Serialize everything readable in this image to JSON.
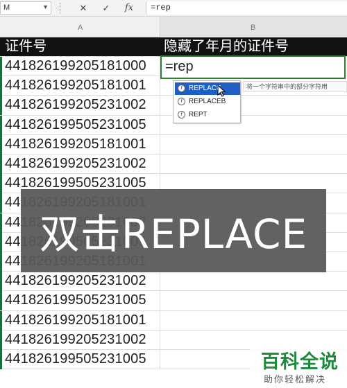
{
  "formula_bar": {
    "namebox": "M",
    "cancel_glyph": "✕",
    "enter_glyph": "✓",
    "fx_glyph": "fx",
    "formula": "=rep"
  },
  "columns": [
    "A",
    "B"
  ],
  "header": {
    "col_a": "证件号",
    "col_b": "隐藏了年月的证件号"
  },
  "active_cell": {
    "value": "=rep"
  },
  "rows": [
    "441826199205181000",
    "441826199205181001",
    "441826199205231002",
    "441826199505231005",
    "441826199205181001",
    "441826199205231002",
    "441826199505231005",
    "441826199205181001",
    "441826199205231002",
    "441826199505231005",
    "441826199205181001",
    "441826199205231002",
    "441826199505231005",
    "441826199205181001",
    "441826199205231002",
    "441826199505231005"
  ],
  "autocomplete": {
    "items": [
      "REPLACE",
      "REPLACEB",
      "REPT"
    ],
    "tooltip": "将一个字符串中的部分字符用"
  },
  "overlay": {
    "caption": "双击REPLACE"
  },
  "watermark": {
    "title": "百科全说",
    "subtitle": "助你轻松解决"
  }
}
